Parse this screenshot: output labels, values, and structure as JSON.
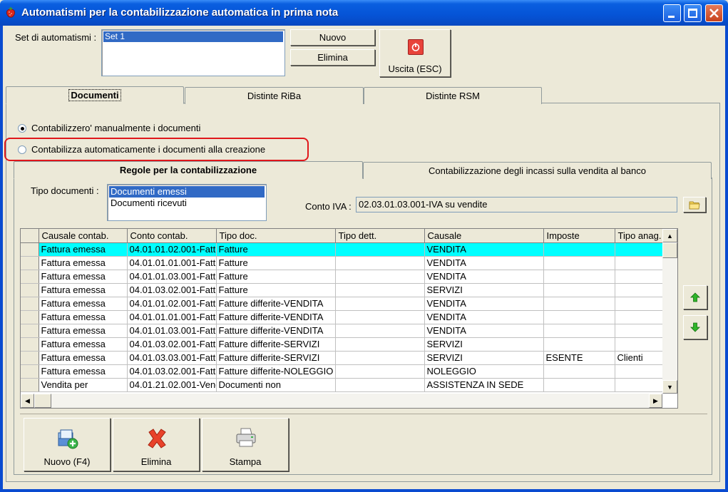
{
  "window": {
    "title": "Automatismi per la contabilizzazione automatica in prima nota"
  },
  "set": {
    "label": "Set di automatismi :",
    "items": [
      "Set 1"
    ],
    "new_label": "Nuovo",
    "delete_label": "Elimina",
    "exit_label": "Uscita (ESC)"
  },
  "tabs": [
    "Documenti",
    "Distinte RiBa",
    "Distinte RSM"
  ],
  "options": {
    "manual": "Contabilizzero' manualmente i documenti",
    "automatic": "Contabilizza automaticamente i documenti alla creazione",
    "selected": "manual"
  },
  "subtabs": [
    "Regole per la contabilizzazione",
    "Contabilizzazione degli incassi sulla vendita al banco"
  ],
  "tipo": {
    "label": "Tipo documenti :",
    "items": [
      "Documenti emessi",
      "Documenti ricevuti"
    ],
    "selected": "Documenti emessi"
  },
  "conto_iva": {
    "label": "Conto IVA :",
    "value": "02.03.01.03.001-IVA su vendite"
  },
  "grid": {
    "columns": [
      "Causale contab.",
      "Conto contab.",
      "Tipo doc.",
      "Tipo dett.",
      "Causale",
      "Imposte",
      "Tipo anag."
    ],
    "rows": [
      [
        "Fattura emessa",
        "04.01.01.02.001-Fattu",
        "Fatture",
        "",
        "VENDITA",
        "",
        ""
      ],
      [
        "Fattura emessa",
        "04.01.01.01.001-Fattu",
        "Fatture",
        "",
        "VENDITA",
        "",
        ""
      ],
      [
        "Fattura emessa",
        "04.01.01.03.001-Fattu",
        "Fatture",
        "",
        "VENDITA",
        "",
        ""
      ],
      [
        "Fattura emessa",
        "04.01.03.02.001-Fattu",
        "Fatture",
        "",
        "SERVIZI",
        "",
        ""
      ],
      [
        "Fattura emessa",
        "04.01.01.02.001-Fattu",
        "Fatture differite-VENDITA",
        "",
        "VENDITA",
        "",
        ""
      ],
      [
        "Fattura emessa",
        "04.01.01.01.001-Fattu",
        "Fatture differite-VENDITA",
        "",
        "VENDITA",
        "",
        ""
      ],
      [
        "Fattura emessa",
        "04.01.01.03.001-Fattu",
        "Fatture differite-VENDITA",
        "",
        "VENDITA",
        "",
        ""
      ],
      [
        "Fattura emessa",
        "04.01.03.02.001-Fattu",
        "Fatture differite-SERVIZI",
        "",
        "SERVIZI",
        "",
        ""
      ],
      [
        "Fattura emessa",
        "04.01.03.03.001-Fattu",
        "Fatture differite-SERVIZI",
        "",
        "SERVIZI",
        "ESENTE",
        "Clienti"
      ],
      [
        "Fattura emessa",
        "04.01.03.02.001-Fattu",
        "Fatture differite-NOLEGGIO",
        "",
        "NOLEGGIO",
        "",
        ""
      ],
      [
        "Vendita per",
        "04.01.21.02.001-Vend",
        "Documenti non",
        "",
        "ASSISTENZA IN SEDE",
        "",
        ""
      ]
    ]
  },
  "footer": {
    "new_label": "Nuovo (F4)",
    "delete_label": "Elimina",
    "print_label": "Stampa"
  },
  "icons": {
    "app": "strawberry-icon",
    "exit": "power-icon",
    "folder": "folder-icon",
    "up": "arrow-up-icon",
    "down": "arrow-down-icon",
    "new": "add-document-icon",
    "delete": "red-x-icon",
    "print": "printer-icon"
  },
  "colors": {
    "titlebar": "#0553D6",
    "highlight_row": "#00FFFF",
    "selection": "#316AC5",
    "annotation": "#E0171B"
  }
}
